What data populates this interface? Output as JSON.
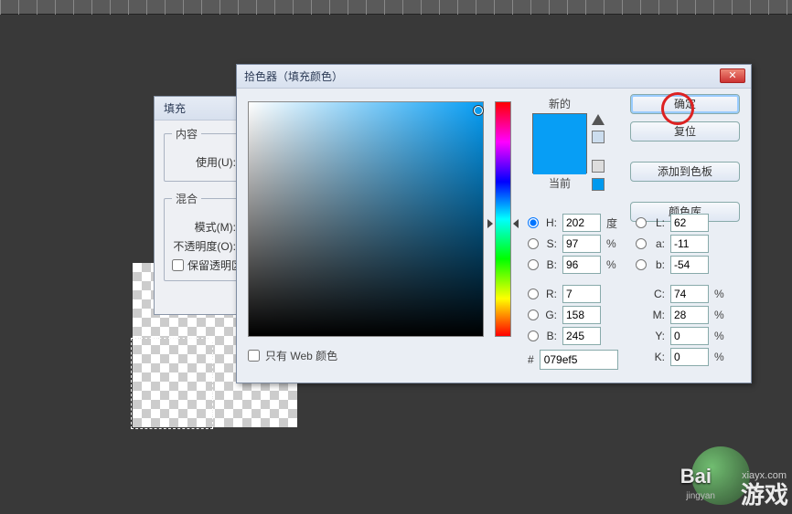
{
  "ruler": {},
  "fill_dialog": {
    "title": "填充",
    "content_legend": "内容",
    "use_label": "使用(U):",
    "blend_legend": "混合",
    "mode_label": "模式(M):",
    "opacity_label": "不透明度(O):",
    "preserve_trans_label": "保留透明区"
  },
  "color_picker": {
    "title": "拾色器（填充颜色）",
    "new_label": "新的",
    "current_label": "当前",
    "ok": "确定",
    "reset": "复位",
    "add_swatch": "添加到色板",
    "color_lib": "颜色库",
    "web_only": "只有 Web 颜色",
    "hex_prefix": "#",
    "hex": "079ef5",
    "hsv": {
      "h_label": "H:",
      "h": "202",
      "h_unit": "度",
      "s_label": "S:",
      "s": "97",
      "s_unit": "%",
      "b_label": "B:",
      "b": "96",
      "b_unit": "%"
    },
    "rgb": {
      "r_label": "R:",
      "r": "7",
      "g_label": "G:",
      "g": "158",
      "b_label": "B:",
      "b": "245"
    },
    "lab": {
      "l_label": "L:",
      "l": "62",
      "a_label": "a:",
      "a": "-11",
      "b_label": "b:",
      "b": "-54"
    },
    "cmyk": {
      "c_label": "C:",
      "c": "74",
      "unit": "%",
      "m_label": "M:",
      "m": "28",
      "y_label": "Y:",
      "y": "0",
      "k_label": "K:",
      "k": "0"
    },
    "swatch": {
      "new": "#079ef5",
      "current": "#079ef5"
    }
  },
  "watermark": {
    "baidu": "Bai",
    "jingyan": "jingyan",
    "site": "xiayx.com",
    "youxi": "游戏"
  }
}
